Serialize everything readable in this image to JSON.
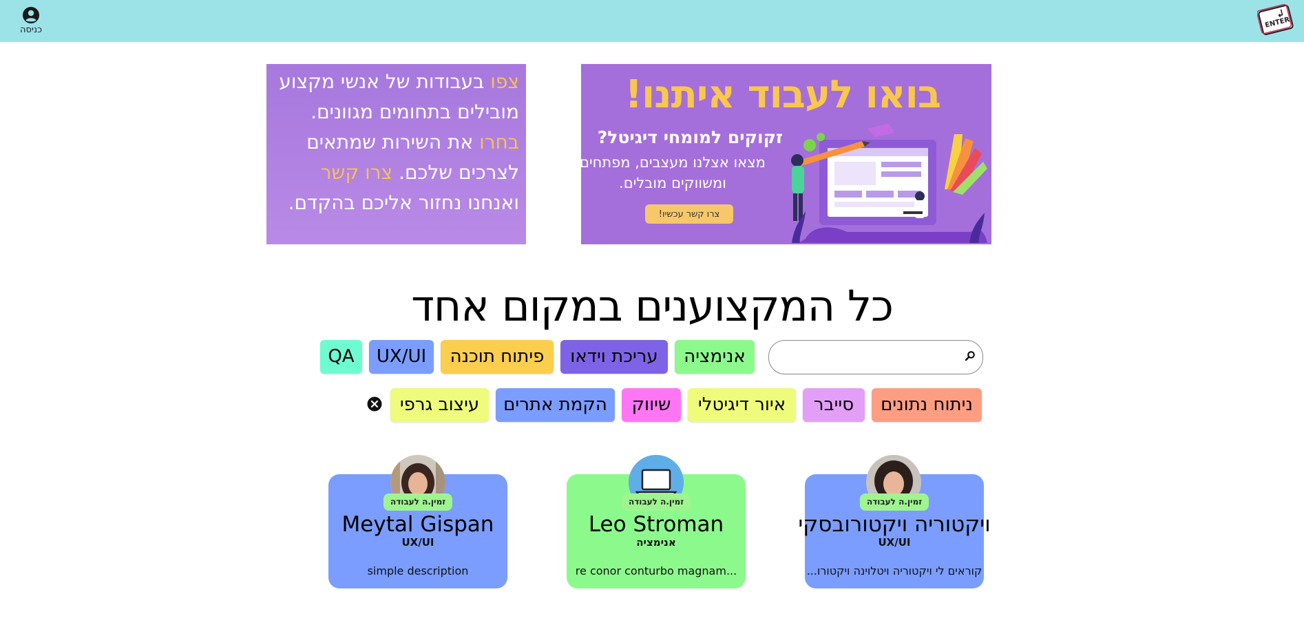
{
  "header": {
    "login_label": "כניסה",
    "logo_text": "ENTER"
  },
  "banner_right": {
    "headline": "בואו לעבוד איתנו!",
    "subheadline": "זקוקים למומחי דיגיטל?",
    "description": "מצאו אצלנו מעצבים, מפתחים ומשווקים מובלים.",
    "cta_label": "צרו קשר עכשיו!"
  },
  "banner_left": {
    "hl1": "צפו",
    "t1": " בעבודות של אנשי מקצוע מובילים בתחומים מגוונים. ",
    "hl2": "בחרו",
    "t2": " את השירות שמתאים לצרכים שלכם. ",
    "hl3": "צרו קשר",
    "t3": " ואנחנו נחזור אליכם בהקדם."
  },
  "main_title": "כל המקצוענים במקום אחד",
  "search": {
    "placeholder": "",
    "value": ""
  },
  "categories": [
    {
      "label": "אנימציה",
      "color": "#8cf98c"
    },
    {
      "label": "עריכת וידאו",
      "color": "#7f63e6"
    },
    {
      "label": "פיתוח תוכנה",
      "color": "#fcce4d"
    },
    {
      "label": "UX/UI",
      "color": "#7a9dff"
    },
    {
      "label": "QA",
      "color": "#6ffbd2"
    },
    {
      "label": "ניתוח נתונים",
      "color": "#fd9e82"
    },
    {
      "label": "סייבר",
      "color": "#e39ff7"
    },
    {
      "label": "איור דיגיטלי",
      "color": "#effb7b"
    },
    {
      "label": "שיווק",
      "color": "#ff76f5"
    },
    {
      "label": "הקמת אתרים",
      "color": "#7a9dff"
    },
    {
      "label": "עיצוב גרפי",
      "color": "#effb7b"
    }
  ],
  "cards": [
    {
      "name": "ויקטוריה ויקטורובסקי",
      "role": "UX/UI",
      "description": "קוראים לי ויקטוריה ויטלוינה ויקטורו...",
      "availability": "זמין.ה לעבודה",
      "color": "#7a9dff"
    },
    {
      "name": "Leo Stroman",
      "role": "אנימציה",
      "description": "...re conor conturbo magnam",
      "availability": "זמין.ה לעבודה",
      "color": "#8cf98c"
    },
    {
      "name": "Meytal Gispan",
      "role": "UX/UI",
      "description": "simple description",
      "availability": "זמין.ה לעבודה",
      "color": "#7a9dff"
    }
  ]
}
